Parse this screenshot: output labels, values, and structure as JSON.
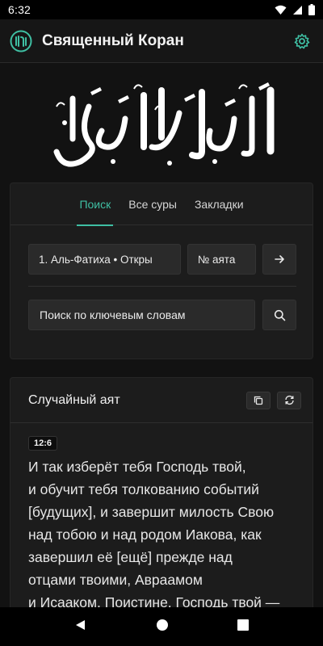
{
  "status_bar": {
    "time": "6:32"
  },
  "app_bar": {
    "title": "Священный Коран"
  },
  "tabs": [
    {
      "label": "Поиск",
      "active": true
    },
    {
      "label": "Все суры",
      "active": false
    },
    {
      "label": "Закладки",
      "active": false
    }
  ],
  "search": {
    "surah_selected": "1. Аль-Фатиха • Откры",
    "ayah_placeholder": "№ аята",
    "keyword_placeholder": "Поиск по ключевым словам"
  },
  "random_ayah": {
    "title": "Случайный аят",
    "reference": "12:6",
    "lines": [
      "И так изберёт тебя Господь твой,",
      "и обучит тебя толкованию событий",
      "[будущих], и завершит милость Свою",
      "над тобою и над родом Иакова, как",
      "завершил её [ещё] прежде над",
      "отцами твоими, Авраамом",
      "и Исааком. Поистине, Господь твой —"
    ]
  },
  "colors": {
    "accent": "#3fbfa3",
    "background": "#121212",
    "card": "#1c1c1c"
  },
  "icons": [
    "wifi-icon",
    "signal-icon",
    "battery-icon",
    "quran-logo-icon",
    "gear-icon",
    "arrow-right-icon",
    "search-icon",
    "copy-icon",
    "refresh-icon",
    "back-icon",
    "home-icon",
    "recents-icon"
  ]
}
